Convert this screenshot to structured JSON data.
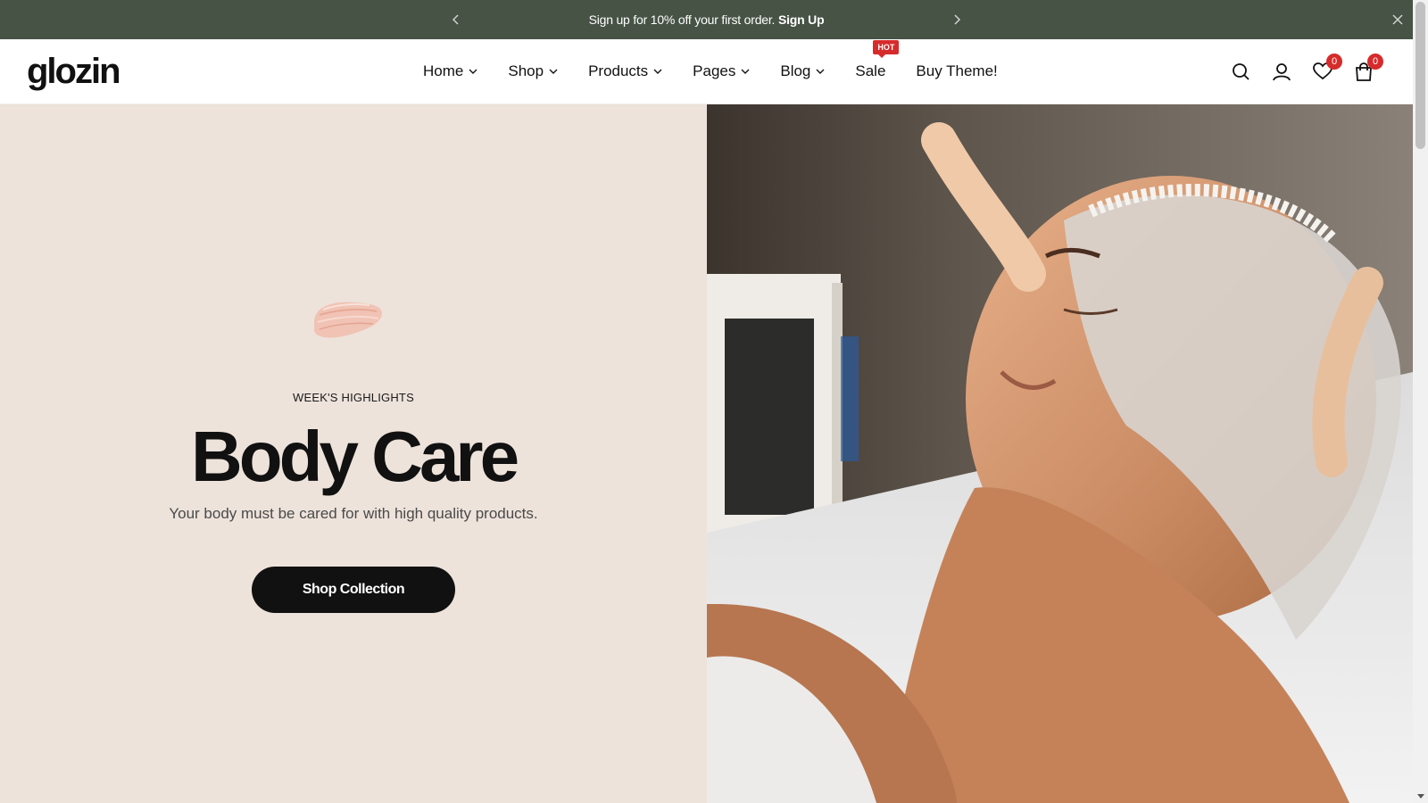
{
  "announcement": {
    "text": "Sign up for 10% off your first order.",
    "link": "Sign Up",
    "bg_color": "#465345"
  },
  "header": {
    "logo": "glozin",
    "nav": [
      {
        "label": "Home",
        "has_dropdown": true
      },
      {
        "label": "Shop",
        "has_dropdown": true
      },
      {
        "label": "Products",
        "has_dropdown": true
      },
      {
        "label": "Pages",
        "has_dropdown": true
      },
      {
        "label": "Blog",
        "has_dropdown": true
      },
      {
        "label": "Sale",
        "has_dropdown": false,
        "badge": "HOT"
      },
      {
        "label": "Buy Theme!",
        "has_dropdown": false
      }
    ],
    "icons": {
      "search": "search-icon",
      "account": "user-icon",
      "wishlist": "heart-icon",
      "wishlist_count": "0",
      "cart": "shopping-bag-icon",
      "cart_count": "0"
    }
  },
  "hero": {
    "eyebrow": "WEEK'S HIGHLIGHTS",
    "title": "Body Care",
    "subtitle": "Your body must be cared for with high quality products.",
    "cta": "Shop Collection",
    "left_bg_color": "#ede3db",
    "accent_badge_color": "#d62b2b"
  }
}
